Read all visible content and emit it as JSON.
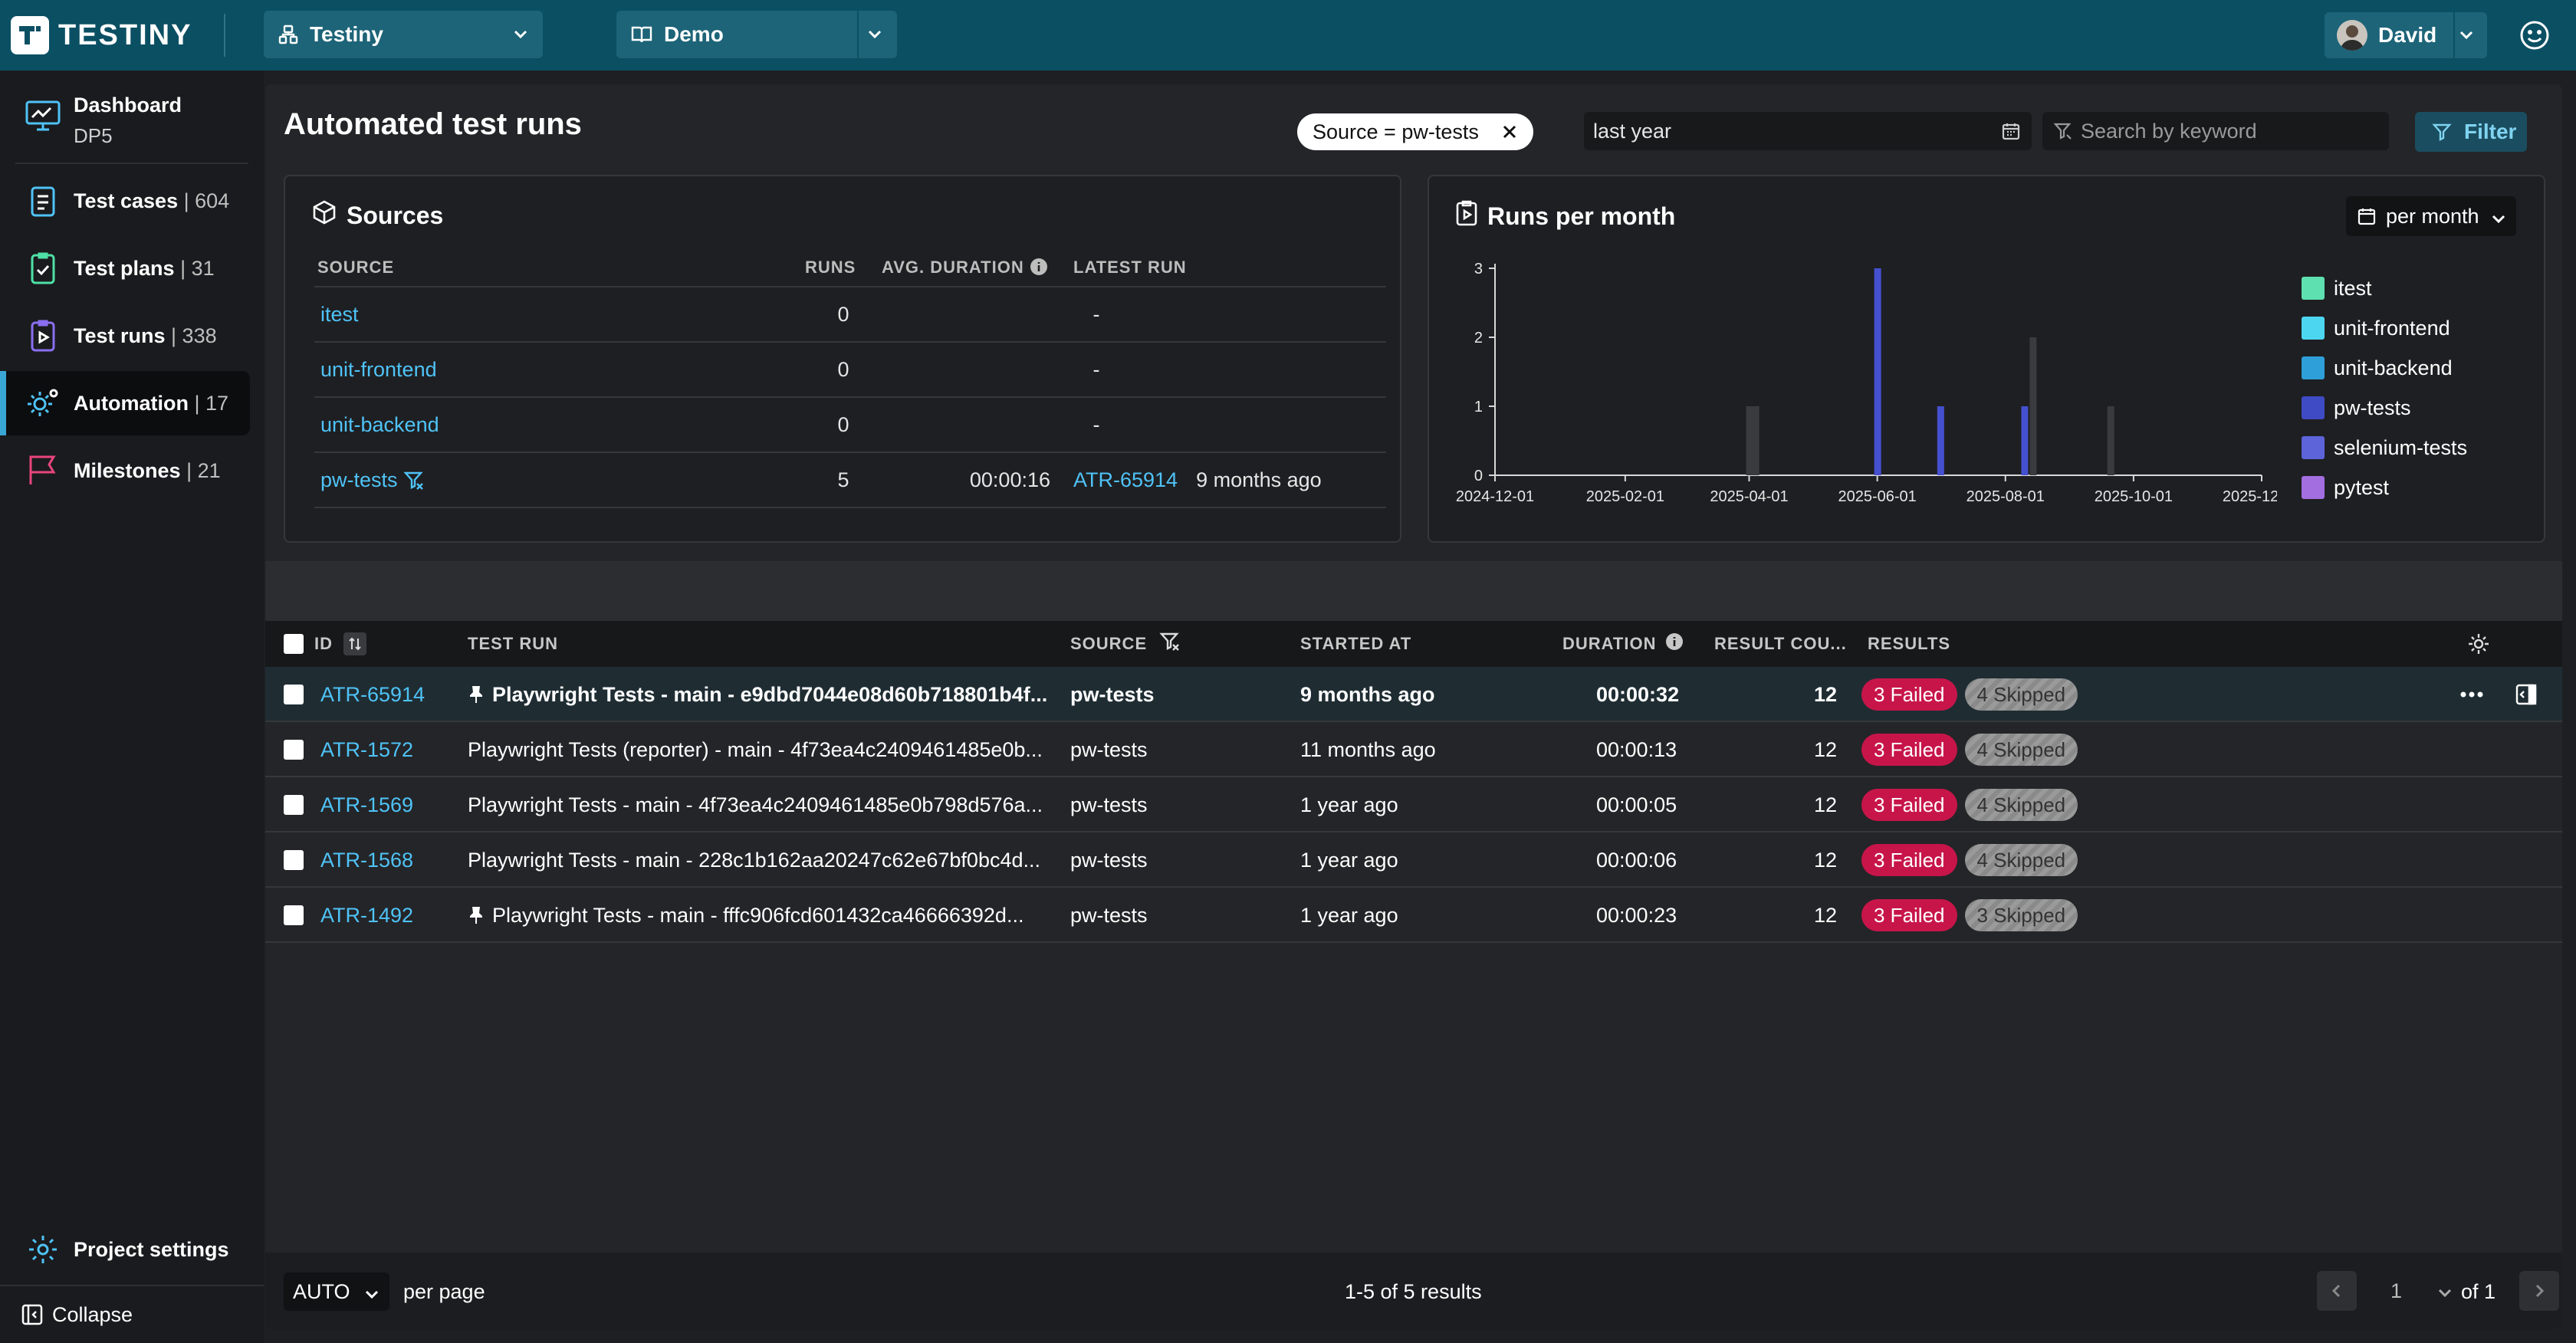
{
  "app": {
    "brand": "TESTINY",
    "colors": {
      "topbar": "#0b4f63",
      "accent": "#4fc3f7",
      "failed": "#c7154a"
    }
  },
  "topbar": {
    "org_selector": "Testiny",
    "project_selector": "Demo",
    "user_name": "David"
  },
  "sidebar": {
    "dashboard": {
      "label": "Dashboard",
      "sub": "DP5"
    },
    "items": [
      {
        "label": "Test cases",
        "count": "| 604",
        "icon": "test-cases-icon"
      },
      {
        "label": "Test plans",
        "count": "| 31",
        "icon": "test-plans-icon"
      },
      {
        "label": "Test runs",
        "count": "| 338",
        "icon": "test-runs-icon"
      },
      {
        "label": "Automation",
        "count": "| 17",
        "icon": "automation-icon"
      },
      {
        "label": "Milestones",
        "count": "| 21",
        "icon": "milestones-icon"
      }
    ],
    "project_settings": "Project settings",
    "collapse": "Collapse"
  },
  "header": {
    "title": "Automated test runs",
    "filter_chip": "Source = pw-tests",
    "date_range": "last year",
    "search_placeholder": "Search by keyword",
    "filter_button": "Filter"
  },
  "sources": {
    "title": "Sources",
    "columns": [
      "SOURCE",
      "RUNS",
      "AVG. DURATION",
      "LATEST RUN"
    ],
    "rows": [
      {
        "source": "itest",
        "runs": "0",
        "avg": "",
        "latest_id": "-",
        "latest_time": ""
      },
      {
        "source": "unit-frontend",
        "runs": "0",
        "avg": "",
        "latest_id": "-",
        "latest_time": ""
      },
      {
        "source": "unit-backend",
        "runs": "0",
        "avg": "",
        "latest_id": "-",
        "latest_time": ""
      },
      {
        "source": "pw-tests",
        "runs": "5",
        "avg": "00:00:16",
        "latest_id": "ATR-65914",
        "latest_time": "9 months ago"
      }
    ]
  },
  "runs_chart": {
    "title": "Runs per month",
    "period_select": "per month"
  },
  "chart_data": {
    "type": "bar",
    "title": "Runs per month",
    "x_ticks": [
      "2024-12-01",
      "2025-02-01",
      "2025-04-01",
      "2025-06-01",
      "2025-08-01",
      "2025-10-01",
      "2025-12-01"
    ],
    "y_ticks": [
      "0",
      "1",
      "2",
      "3"
    ],
    "ylim": [
      0,
      3
    ],
    "legend": [
      {
        "name": "itest",
        "color": "#5ee0b0"
      },
      {
        "name": "unit-frontend",
        "color": "#4dd6f0"
      },
      {
        "name": "unit-backend",
        "color": "#2e9fd8"
      },
      {
        "name": "pw-tests",
        "color": "#3f4bc4"
      },
      {
        "name": "selenium-tests",
        "color": "#5d63d9"
      },
      {
        "name": "pytest",
        "color": "#a36ee0"
      }
    ],
    "bars": [
      {
        "x": "2025-04-01",
        "y": 1,
        "series": "other",
        "color": "#3a3b3e"
      },
      {
        "x": "2025-04-04",
        "y": 1,
        "series": "other",
        "color": "#3a3b3e"
      },
      {
        "x": "2025-06-01",
        "y": 3,
        "series": "pw-tests",
        "color": "#4550d0"
      },
      {
        "x": "2025-07-01",
        "y": 1,
        "series": "pw-tests",
        "color": "#4550d0"
      },
      {
        "x": "2025-08-10",
        "y": 1,
        "series": "pw-tests",
        "color": "#4550d0"
      },
      {
        "x": "2025-08-14",
        "y": 2,
        "series": "other",
        "color": "#3a3b3e"
      },
      {
        "x": "2025-09-20",
        "y": 1,
        "series": "other",
        "color": "#3a3b3e"
      }
    ],
    "legend_placement": "right"
  },
  "table": {
    "columns": {
      "id": "ID",
      "test_run": "TEST RUN",
      "source": "SOURCE",
      "started": "STARTED AT",
      "duration": "DURATION",
      "result_count": "RESULT COU...",
      "results": "RESULTS"
    },
    "rows": [
      {
        "id": "ATR-65914",
        "pinned": true,
        "name": "Playwright Tests - main - e9dbd7044e08d60b718801b4f...",
        "source": "pw-tests",
        "started": "9 months ago",
        "duration": "00:00:32",
        "count": "12",
        "failed": "3 Failed",
        "skipped": "4 Skipped",
        "selected": true
      },
      {
        "id": "ATR-1572",
        "pinned": false,
        "name": "Playwright Tests (reporter) - main - 4f73ea4c2409461485e0b...",
        "source": "pw-tests",
        "started": "11 months ago",
        "duration": "00:00:13",
        "count": "12",
        "failed": "3 Failed",
        "skipped": "4 Skipped",
        "selected": false
      },
      {
        "id": "ATR-1569",
        "pinned": false,
        "name": "Playwright Tests - main - 4f73ea4c2409461485e0b798d576a...",
        "source": "pw-tests",
        "started": "1 year ago",
        "duration": "00:00:05",
        "count": "12",
        "failed": "3 Failed",
        "skipped": "4 Skipped",
        "selected": false
      },
      {
        "id": "ATR-1568",
        "pinned": false,
        "name": "Playwright Tests - main - 228c1b162aa20247c62e67bf0bc4d...",
        "source": "pw-tests",
        "started": "1 year ago",
        "duration": "00:00:06",
        "count": "12",
        "failed": "3 Failed",
        "skipped": "4 Skipped",
        "selected": false
      },
      {
        "id": "ATR-1492",
        "pinned": true,
        "name": "Playwright Tests - main - fffc906fcd601432ca46666392d...",
        "source": "pw-tests",
        "started": "1 year ago",
        "duration": "00:00:23",
        "count": "12",
        "failed": "3 Failed",
        "skipped": "3 Skipped",
        "selected": false
      }
    ]
  },
  "footer": {
    "per_page_value": "AUTO",
    "per_page_label": "per page",
    "results_summary": "1-5 of 5 results",
    "page": "1",
    "page_total": "of 1"
  }
}
